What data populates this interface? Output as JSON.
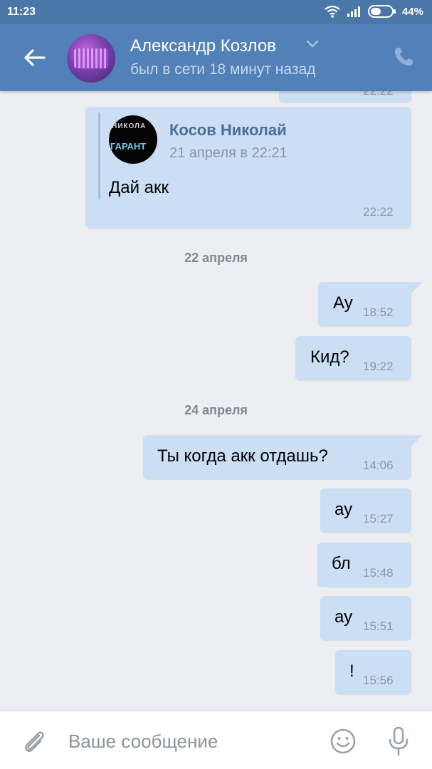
{
  "status_bar": {
    "time": "11:23",
    "battery": "44%"
  },
  "header": {
    "contact_name": "Александр Козлов",
    "contact_status": "был в сети 18 минут назад"
  },
  "chat": {
    "top_partial_time": "22:22",
    "forwarded": {
      "sender": "Косов Николай",
      "date": "21 апреля в 22:21",
      "text": "Дай акк",
      "time": "22:22",
      "avatar_line1": "НИКОЛА",
      "avatar_line2": "ГАРАНТ"
    },
    "date_separators": [
      "22 апреля",
      "24 апреля"
    ],
    "messages": [
      {
        "text": "Ау",
        "time": "18:52"
      },
      {
        "text": "Кид?",
        "time": "19:22"
      },
      {
        "text": "Ты когда акк отдашь?",
        "time": "14:06"
      },
      {
        "text": "ау",
        "time": "15:27"
      },
      {
        "text": "бл",
        "time": "15:48"
      },
      {
        "text": "ау",
        "time": "15:51"
      },
      {
        "text": "!",
        "time": "15:56"
      }
    ]
  },
  "input": {
    "placeholder": "Ваше сообщение"
  },
  "colors": {
    "header": "#5181b8",
    "status_bar": "#4a76a8",
    "bubble": "#ccdef3",
    "background": "#edeef0"
  }
}
